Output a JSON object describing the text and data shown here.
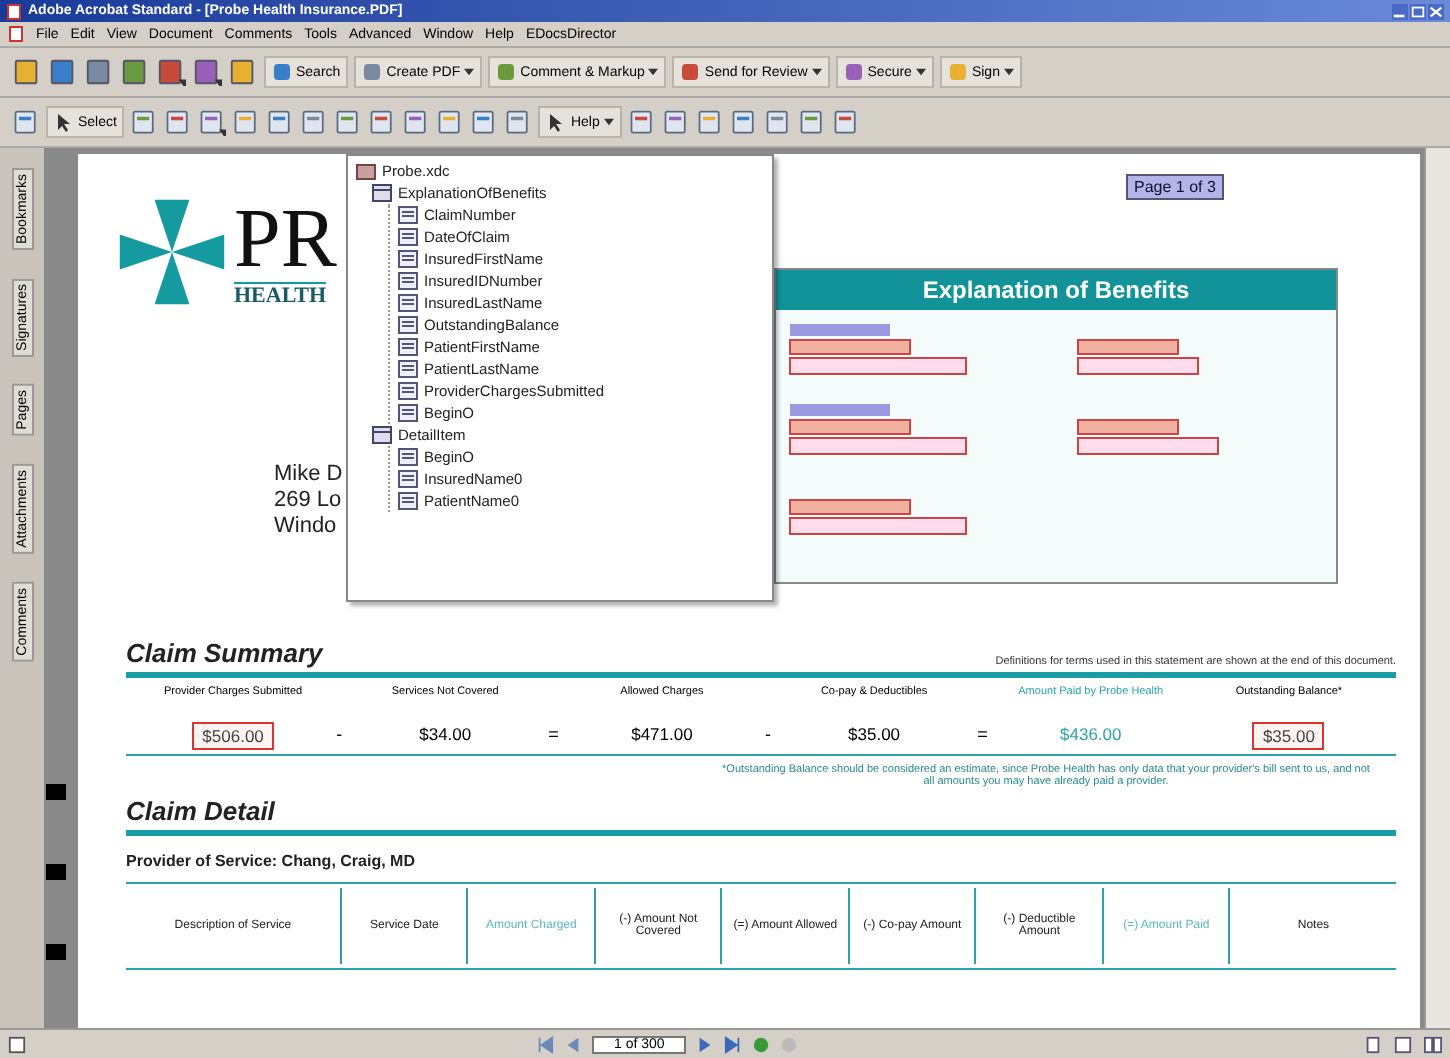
{
  "window": {
    "title": "Adobe Acrobat Standard - [Probe Health Insurance.PDF]"
  },
  "menu": [
    "File",
    "Edit",
    "View",
    "Document",
    "Comments",
    "Tools",
    "Advanced",
    "Window",
    "Help",
    "EDocsDirector"
  ],
  "toolbar": [
    {
      "kind": "icon",
      "dropdown": false
    },
    {
      "kind": "icon",
      "dropdown": false
    },
    {
      "kind": "icon",
      "dropdown": false
    },
    {
      "kind": "icon",
      "dropdown": false
    },
    {
      "kind": "icon",
      "dropdown": true
    },
    {
      "kind": "icon",
      "dropdown": true
    },
    {
      "kind": "icon",
      "dropdown": false
    },
    {
      "kind": "button",
      "label": "Search",
      "dropdown": false
    },
    {
      "kind": "button",
      "label": "Create PDF",
      "dropdown": true
    },
    {
      "kind": "button",
      "label": "Comment & Markup",
      "dropdown": true
    },
    {
      "kind": "button",
      "label": "Send for Review",
      "dropdown": true
    },
    {
      "kind": "button",
      "label": "Secure",
      "dropdown": true
    },
    {
      "kind": "button",
      "label": "Sign",
      "dropdown": true
    }
  ],
  "toolbar2": [
    {
      "kind": "icon",
      "dropdown": false
    },
    {
      "kind": "button",
      "label": "Select",
      "dropdown": false
    },
    {
      "kind": "icon",
      "dropdown": false
    },
    {
      "kind": "icon",
      "dropdown": false
    },
    {
      "kind": "icon",
      "dropdown": true
    },
    {
      "kind": "icon",
      "dropdown": false
    },
    {
      "kind": "icon",
      "dropdown": false
    },
    {
      "kind": "icon",
      "dropdown": false
    },
    {
      "kind": "icon",
      "dropdown": false
    },
    {
      "kind": "icon",
      "dropdown": false
    },
    {
      "kind": "icon",
      "dropdown": false
    },
    {
      "kind": "icon",
      "dropdown": false
    },
    {
      "kind": "icon",
      "dropdown": false
    },
    {
      "kind": "icon",
      "dropdown": false
    },
    {
      "kind": "button",
      "label": "Help",
      "dropdown": true
    },
    {
      "kind": "icon",
      "dropdown": false
    },
    {
      "kind": "icon",
      "dropdown": false
    },
    {
      "kind": "icon",
      "dropdown": false
    },
    {
      "kind": "icon",
      "dropdown": false
    },
    {
      "kind": "icon",
      "dropdown": false
    },
    {
      "kind": "icon",
      "dropdown": false
    },
    {
      "kind": "icon",
      "dropdown": false
    }
  ],
  "side_tabs": [
    "Bookmarks",
    "Signatures",
    "Pages",
    "Attachments",
    "Comments"
  ],
  "tree": {
    "label": "Probe.xdc",
    "children": [
      {
        "label": "ExplanationOfBenefits",
        "children": [
          {
            "label": "ClaimNumber"
          },
          {
            "label": "DateOfClaim"
          },
          {
            "label": "InsuredFirstName"
          },
          {
            "label": "InsuredIDNumber"
          },
          {
            "label": "InsuredLastName"
          },
          {
            "label": "OutstandingBalance"
          },
          {
            "label": "PatientFirstName"
          },
          {
            "label": "PatientLastName"
          },
          {
            "label": "ProviderChargesSubmitted"
          },
          {
            "label": "BeginO"
          }
        ]
      },
      {
        "label": "DetailItem",
        "children": [
          {
            "label": "BeginO"
          },
          {
            "label": "InsuredName0"
          },
          {
            "label": "PatientName0"
          }
        ]
      }
    ]
  },
  "logo": {
    "name": "PR",
    "subtitle": "HEALTH"
  },
  "address": [
    "Mike D",
    "269 Lo",
    "Windo"
  ],
  "page_field": "Page 1 of 3",
  "eob": {
    "title": "Explanation of Benefits"
  },
  "summary": {
    "title": "Claim Summary",
    "note": "Definitions for terms used in this statement are shown at the end of this document.",
    "columns": [
      {
        "label": "Provider Charges Submitted",
        "value": "$506.00",
        "kind": "field",
        "op": "-"
      },
      {
        "label": "Services Not Covered",
        "value": "$34.00",
        "kind": "plain",
        "op": "="
      },
      {
        "label": "Allowed Charges",
        "value": "$471.00",
        "kind": "plain",
        "op": "-"
      },
      {
        "label": "Co-pay & Deductibles",
        "value": "$35.00",
        "kind": "plain",
        "op": "="
      },
      {
        "label": "Amount Paid by Probe Health",
        "value": "$436.00",
        "kind": "teal"
      },
      {
        "label": "Outstanding Balance*",
        "value": "$35.00",
        "kind": "field"
      }
    ],
    "footnote": "*Outstanding Balance should be considered an estimate, since Probe Health has only data that your provider's bill sent to us, and not all amounts you may have already paid a provider."
  },
  "detail": {
    "title": "Claim Detail",
    "provider": "Provider of Service: Chang, Craig, MD",
    "columns": [
      {
        "label": "Description of Service",
        "kind": "plain"
      },
      {
        "label": "Service Date",
        "kind": "plain"
      },
      {
        "label": "Amount Charged",
        "kind": "teal"
      },
      {
        "label": "(-) Amount Not Covered",
        "kind": "plain"
      },
      {
        "label": "(=) Amount Allowed",
        "kind": "plain"
      },
      {
        "label": "(-) Co-pay Amount",
        "kind": "plain"
      },
      {
        "label": "(-) Deductible Amount",
        "kind": "plain"
      },
      {
        "label": "(=) Amount Paid",
        "kind": "teal"
      },
      {
        "label": "Notes",
        "kind": "plain"
      }
    ]
  },
  "status_bar": {
    "page": "1 of 300"
  }
}
